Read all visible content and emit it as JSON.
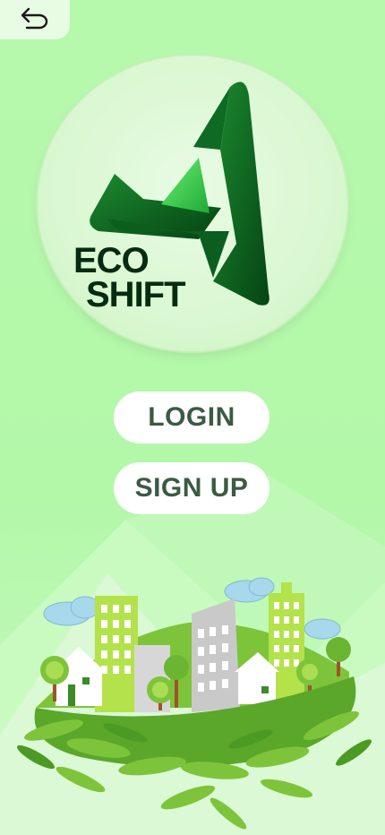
{
  "header": {
    "back_icon": "undo-arrow-icon"
  },
  "logo": {
    "line1": "ECO",
    "line2": "SHIFT",
    "colors": {
      "dark_green": "#0a5a1c",
      "bright_green": "#31c24a",
      "text": "#062b10"
    }
  },
  "auth": {
    "login_label": "LOGIN",
    "signup_label": "SIGN UP"
  },
  "theme": {
    "background": "#b6f9ad",
    "button_bg": "#ffffff",
    "button_text": "#3b5a43"
  },
  "illustration": {
    "name": "green-city-illustration"
  }
}
